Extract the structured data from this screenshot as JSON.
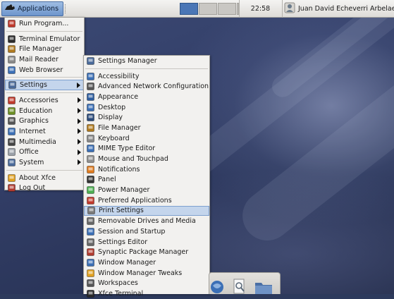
{
  "panel": {
    "applications_label": "Applications",
    "clock": "22:58",
    "user_name": "Juan David Echeverri Arbelaez",
    "workspaces": [
      {
        "active": true
      },
      {
        "active": false
      },
      {
        "active": false
      },
      {
        "active": false
      }
    ]
  },
  "main_menu": {
    "items": [
      {
        "label": "Run Program...",
        "icon": "run-icon",
        "color": "#c0392b"
      },
      {
        "sep": true
      },
      {
        "label": "Terminal Emulator",
        "icon": "terminal-icon",
        "color": "#2b2b2b"
      },
      {
        "label": "File Manager",
        "icon": "folder-icon",
        "color": "#b07a1e"
      },
      {
        "label": "Mail Reader",
        "icon": "mail-icon",
        "color": "#8a8a8a"
      },
      {
        "label": "Web Browser",
        "icon": "globe-icon",
        "color": "#3b6fb6"
      },
      {
        "sep": true
      },
      {
        "label": "Settings",
        "icon": "settings-icon",
        "color": "#4a6a9a",
        "submenu": true,
        "highlighted": true
      },
      {
        "sep": true
      },
      {
        "label": "Accessories",
        "icon": "accessories-icon",
        "color": "#c0392b",
        "submenu": true
      },
      {
        "label": "Education",
        "icon": "education-icon",
        "color": "#6b8e23",
        "submenu": true
      },
      {
        "label": "Graphics",
        "icon": "graphics-icon",
        "color": "#555555",
        "submenu": true
      },
      {
        "label": "Internet",
        "icon": "internet-icon",
        "color": "#3b6fb6",
        "submenu": true
      },
      {
        "label": "Multimedia",
        "icon": "multimedia-icon",
        "color": "#444444",
        "submenu": true
      },
      {
        "label": "Office",
        "icon": "office-icon",
        "color": "#9aa0a8",
        "submenu": true
      },
      {
        "label": "System",
        "icon": "system-icon",
        "color": "#4a6a9a",
        "submenu": true
      },
      {
        "sep": true
      },
      {
        "label": "About Xfce",
        "icon": "about-icon",
        "color": "#e0a020"
      },
      {
        "label": "Log Out",
        "icon": "logout-icon",
        "color": "#b03a2e"
      }
    ]
  },
  "settings_menu": {
    "items": [
      {
        "label": "Settings Manager",
        "icon": "settings-manager-icon",
        "color": "#4a6a9a"
      },
      {
        "sep": true
      },
      {
        "label": "Accessibility",
        "icon": "accessibility-icon",
        "color": "#3b6fb6"
      },
      {
        "label": "Advanced Network Configuration",
        "icon": "network-icon",
        "color": "#555555"
      },
      {
        "label": "Appearance",
        "icon": "appearance-icon",
        "color": "#2d5d9f"
      },
      {
        "label": "Desktop",
        "icon": "desktop-icon",
        "color": "#3b6fb6"
      },
      {
        "label": "Display",
        "icon": "display-icon",
        "color": "#2a4a7a"
      },
      {
        "label": "File Manager",
        "icon": "folder-icon",
        "color": "#b07a1e"
      },
      {
        "label": "Keyboard",
        "icon": "keyboard-icon",
        "color": "#888888"
      },
      {
        "label": "MIME Type Editor",
        "icon": "mime-icon",
        "color": "#3b6fb6"
      },
      {
        "label": "Mouse and Touchpad",
        "icon": "mouse-icon",
        "color": "#8f8f8f"
      },
      {
        "label": "Notifications",
        "icon": "notifications-icon",
        "color": "#e07b1e"
      },
      {
        "label": "Panel",
        "icon": "panel-icon",
        "color": "#333333"
      },
      {
        "label": "Power Manager",
        "icon": "power-icon",
        "color": "#4caf50"
      },
      {
        "label": "Preferred Applications",
        "icon": "preferred-apps-icon",
        "color": "#c0392b"
      },
      {
        "label": "Print Settings",
        "icon": "printer-icon",
        "color": "#7a7a7a",
        "highlighted": true
      },
      {
        "label": "Removable Drives and Media",
        "icon": "drive-icon",
        "color": "#666666"
      },
      {
        "label": "Session and Startup",
        "icon": "session-icon",
        "color": "#3b6fb6"
      },
      {
        "label": "Settings Editor",
        "icon": "settings-editor-icon",
        "color": "#666666"
      },
      {
        "label": "Synaptic Package Manager",
        "icon": "package-icon",
        "color": "#b03a2e"
      },
      {
        "label": "Window Manager",
        "icon": "window-manager-icon",
        "color": "#3b6fb6"
      },
      {
        "label": "Window Manager Tweaks",
        "icon": "wm-tweaks-icon",
        "color": "#e0a020"
      },
      {
        "label": "Workspaces",
        "icon": "workspaces-icon",
        "color": "#555555"
      },
      {
        "label": "Xfce Terminal",
        "icon": "terminal-icon",
        "color": "#2b2b2b"
      }
    ]
  },
  "dock": {
    "items": [
      {
        "icon": "web-browser-icon",
        "color": "#3b6fb6"
      },
      {
        "icon": "search-icon",
        "color": "#6a7a8a"
      },
      {
        "icon": "folder-icon",
        "color": "#4a6fa5"
      }
    ]
  }
}
